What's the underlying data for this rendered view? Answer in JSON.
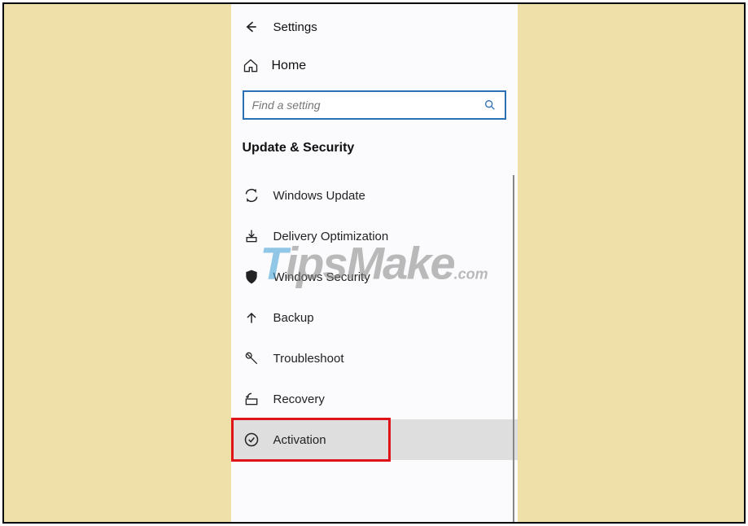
{
  "header": {
    "title": "Settings"
  },
  "home": {
    "label": "Home"
  },
  "search": {
    "placeholder": "Find a setting"
  },
  "section": {
    "title": "Update & Security"
  },
  "menu": {
    "items": [
      {
        "label": "Windows Update",
        "icon": "sync-icon"
      },
      {
        "label": "Delivery Optimization",
        "icon": "delivery-icon"
      },
      {
        "label": "Windows Security",
        "icon": "shield-icon"
      },
      {
        "label": "Backup",
        "icon": "backup-arrow-icon"
      },
      {
        "label": "Troubleshoot",
        "icon": "wrench-icon"
      },
      {
        "label": "Recovery",
        "icon": "recovery-icon"
      },
      {
        "label": "Activation",
        "icon": "check-circle-icon",
        "selected": true,
        "highlighted": true
      }
    ]
  },
  "watermark": {
    "text_parts": {
      "t": "T",
      "rest": "ipsMake",
      "suffix": ".com"
    }
  }
}
